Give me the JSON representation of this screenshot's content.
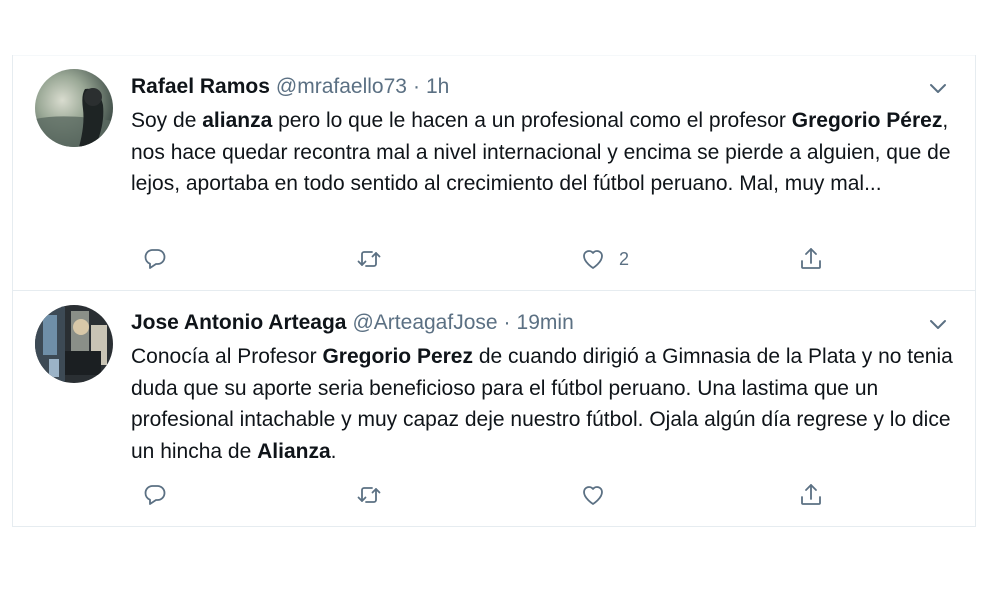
{
  "tweets": [
    {
      "author_name": "Rafael Ramos",
      "handle": "@mrafaello73",
      "separator": "·",
      "time": "1h",
      "text_parts": [
        "Soy de ",
        "alianza",
        " pero lo que le hacen a un profesional como el profesor ",
        "Gregorio Pérez",
        ", nos hace quedar recontra mal a nivel internacional y encima se pierde a alguien, que de lejos, aportaba en todo sentido al crecimiento del fútbol peruano. Mal, muy mal..."
      ],
      "like_count": "2",
      "icons": {
        "reply": "reply-icon",
        "retweet": "retweet-icon",
        "like": "heart-icon",
        "share": "share-icon",
        "menu": "chevron-down-icon"
      }
    },
    {
      "author_name": "Jose Antonio Arteaga",
      "handle": "@ArteagafJose",
      "separator": "·",
      "time": "19min",
      "text_parts": [
        "Conocía al Profesor ",
        "Gregorio Perez",
        " de cuando dirigió a Gimnasia de la Plata y no tenia duda que su aporte seria beneficioso para el fútbol peruano. Una lastima que un profesional intachable y muy capaz deje nuestro fútbol. Ojala algún día regrese y lo dice un hincha de ",
        "Alianza",
        "."
      ],
      "like_count": "",
      "icons": {
        "reply": "reply-icon",
        "retweet": "retweet-icon",
        "like": "heart-icon",
        "share": "share-icon",
        "menu": "chevron-down-icon"
      }
    }
  ],
  "colors": {
    "text": "#0f1419",
    "secondary": "#5b7083",
    "divider": "#e6ecf0"
  }
}
